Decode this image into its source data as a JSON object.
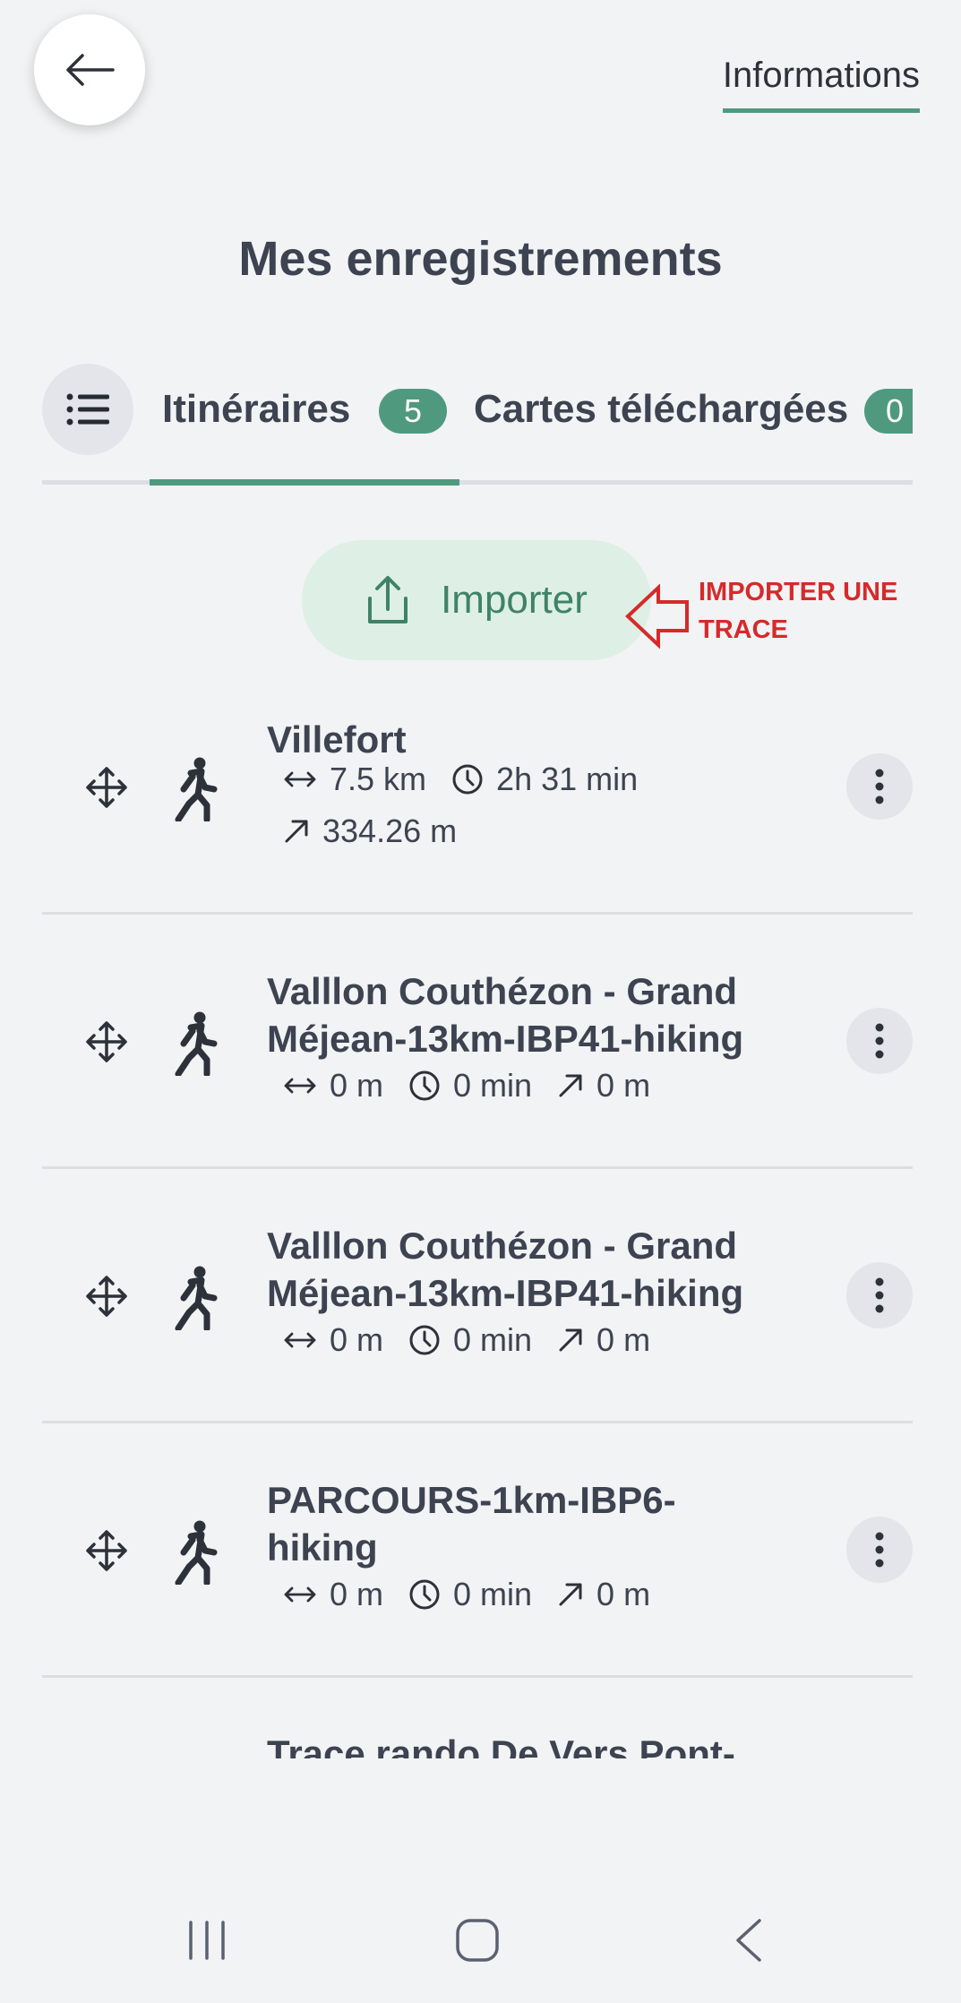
{
  "header": {
    "back_icon": "arrow-left-icon",
    "info_link": "Informations",
    "title": "Mes enregistrements"
  },
  "tabs": {
    "list_icon": "list-icon",
    "items": [
      {
        "label": "Itinéraires",
        "count": "5",
        "active": true
      },
      {
        "label": "Cartes téléchargées",
        "count": "0",
        "active": false
      }
    ]
  },
  "import": {
    "icon": "upload-icon",
    "label": "Importer",
    "annotation_line1": "IMPORTER UNE",
    "annotation_line2": "TRACE"
  },
  "routes": [
    {
      "title_line1": "Villefort",
      "title_line2": "",
      "distance": "7.5 km",
      "duration": "2h 31 min",
      "elevation": "334.26 m"
    },
    {
      "title_line1": "Valllon Couthézon - Grand",
      "title_line2": "Méjean-13km-IBP41-hiking",
      "distance": "0 m",
      "duration": "0 min",
      "elevation": "0 m"
    },
    {
      "title_line1": "Valllon Couthézon - Grand",
      "title_line2": "Méjean-13km-IBP41-hiking",
      "distance": "0 m",
      "duration": "0 min",
      "elevation": "0 m"
    },
    {
      "title_line1": "PARCOURS-1km-IBP6-",
      "title_line2": "hiking",
      "distance": "0 m",
      "duration": "0 min",
      "elevation": "0 m"
    },
    {
      "title_line1": "Trace rando De Vers Pont-",
      "title_line2": "",
      "distance": "",
      "duration": "",
      "elevation": ""
    }
  ],
  "colors": {
    "accent": "#4f9a7f",
    "annotation": "#d62a2a",
    "background": "#f2f3f5"
  }
}
